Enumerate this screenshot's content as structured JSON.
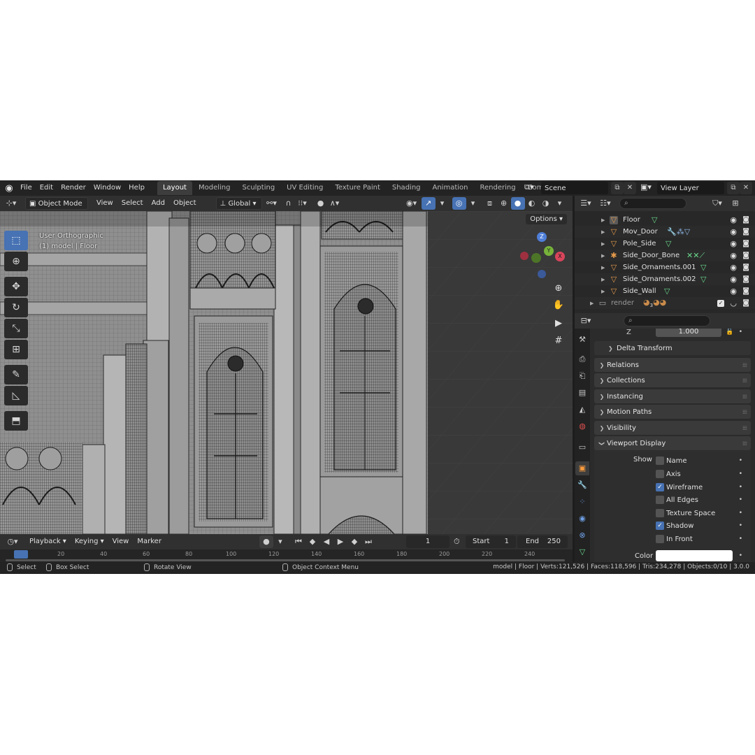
{
  "topbar": {
    "menus": [
      "File",
      "Edit",
      "Render",
      "Window",
      "Help"
    ],
    "workspaces": [
      "Layout",
      "Modeling",
      "Sculpting",
      "UV Editing",
      "Texture Paint",
      "Shading",
      "Animation",
      "Rendering",
      "Compo"
    ],
    "active_workspace": "Layout",
    "scene": "Scene",
    "view_layer": "View Layer"
  },
  "viewport_header": {
    "mode": "Object Mode",
    "menus": [
      "View",
      "Select",
      "Add",
      "Object"
    ],
    "orientation": "Global"
  },
  "viewport": {
    "view_name": "User Orthographic",
    "context": "(1) model | Floor",
    "options_label": "Options",
    "gizmo": {
      "z": "Z",
      "y": "Y",
      "x": "X"
    }
  },
  "outliner": {
    "rows": [
      {
        "label": "Floor",
        "selected": true
      },
      {
        "label": "Mov_Door",
        "selected": false
      },
      {
        "label": "Pole_Side",
        "selected": false
      },
      {
        "label": "Side_Door_Bone",
        "selected": false
      },
      {
        "label": "Side_Ornaments.001",
        "selected": false
      },
      {
        "label": "Side_Ornaments.002",
        "selected": false
      },
      {
        "label": "Side_Wall",
        "selected": false
      },
      {
        "label": "render",
        "selected": false
      }
    ],
    "render_badge": "3"
  },
  "properties": {
    "z_label": "Z",
    "z_value": "1.000",
    "delta_transform": "Delta Transform",
    "panels": [
      "Relations",
      "Collections",
      "Instancing",
      "Motion Paths",
      "Visibility"
    ],
    "viewport_display": "Viewport Display",
    "show_label": "Show",
    "show_items": [
      {
        "label": "Name",
        "checked": false
      },
      {
        "label": "Axis",
        "checked": false
      },
      {
        "label": "Wireframe",
        "checked": true
      },
      {
        "label": "All Edges",
        "checked": false
      },
      {
        "label": "Texture Space",
        "checked": false
      },
      {
        "label": "Shadow",
        "checked": true
      },
      {
        "label": "In Front",
        "checked": false
      }
    ],
    "color_label": "Color",
    "color_value": "#ffffff"
  },
  "timeline": {
    "menus": [
      "Playback",
      "Keying",
      "View",
      "Marker"
    ],
    "current_frame": "1",
    "start_label": "Start",
    "start_value": "1",
    "end_label": "End",
    "end_value": "250",
    "ruler": [
      "20",
      "40",
      "60",
      "80",
      "100",
      "120",
      "140",
      "160",
      "180",
      "200",
      "220",
      "240"
    ]
  },
  "statusbar": {
    "select": "Select",
    "box_select": "Box Select",
    "rotate_view": "Rotate View",
    "context_menu": "Object Context Menu",
    "stats": "model | Floor | Verts:121,526 | Faces:118,596 | Tris:234,278 | Objects:0/10 | 3.0.0"
  },
  "colors": {
    "accent": "#4772b3",
    "object_orange": "#e59a4b",
    "modifier_green": "#6bdb8e"
  }
}
